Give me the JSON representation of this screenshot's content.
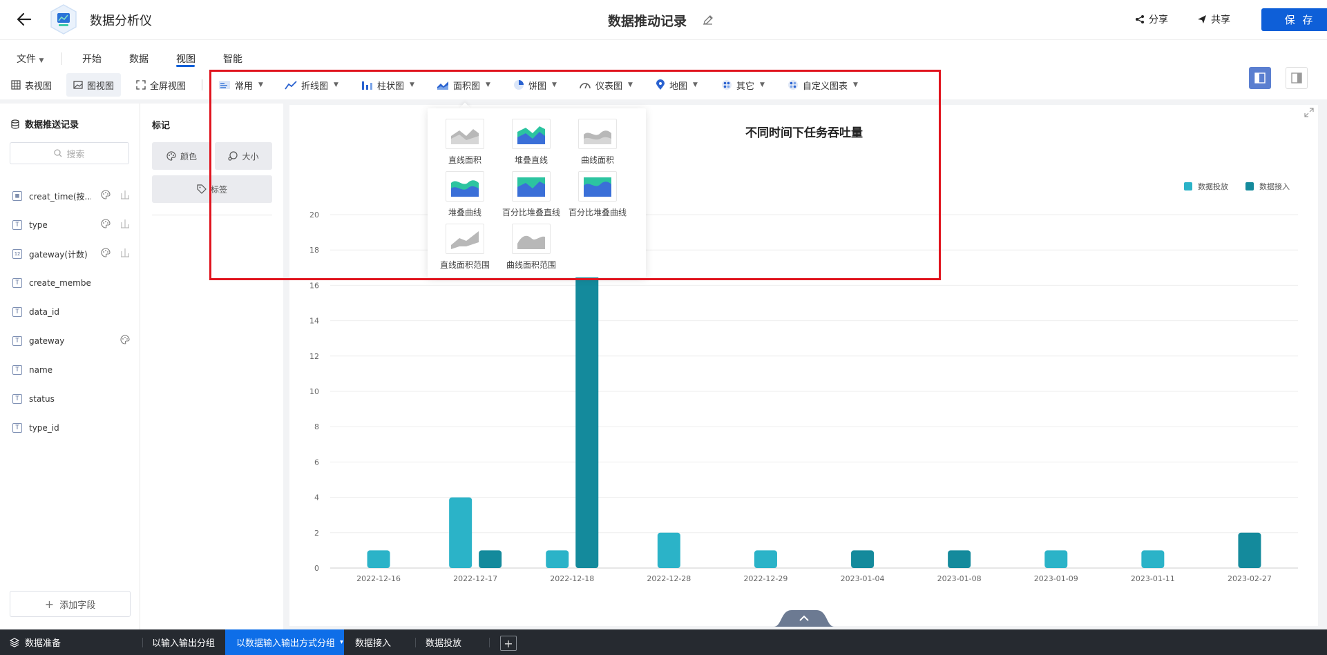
{
  "header": {
    "app_name": "数据分析仪",
    "doc_title": "数据推动记录",
    "share_label": "分享",
    "collab_label": "共享",
    "save_label": "保 存"
  },
  "menu": {
    "file": "文件",
    "start": "开始",
    "data": "数据",
    "view": "视图",
    "smart": "智能"
  },
  "toolbar": {
    "table_view": "表视图",
    "graph_view": "图视图",
    "fullscreen": "全屏视图",
    "common": "常用",
    "line": "折线图",
    "bar": "柱状图",
    "area": "面积图",
    "pie": "饼图",
    "gauge": "仪表图",
    "map": "地图",
    "other": "其它",
    "custom": "自定义图表"
  },
  "field_panel": {
    "title": "数据推送记录",
    "search_placeholder": "搜索",
    "fields": [
      {
        "name": "creat_time(按...",
        "type": "date"
      },
      {
        "name": "type",
        "type": "text"
      },
      {
        "name": "gateway(计数)",
        "type": "number"
      },
      {
        "name": "create_member",
        "type": "text"
      },
      {
        "name": "data_id",
        "type": "text"
      },
      {
        "name": "gateway",
        "type": "text"
      },
      {
        "name": "name",
        "type": "text"
      },
      {
        "name": "status",
        "type": "text"
      },
      {
        "name": "type_id",
        "type": "text"
      }
    ],
    "add_field": "添加字段"
  },
  "mark_panel": {
    "title": "标记",
    "color": "颜色",
    "size": "大小",
    "label": "标签"
  },
  "dropdown": {
    "items": [
      "直线面积",
      "堆叠直线",
      "曲线面积",
      "堆叠曲线",
      "百分比堆叠直线",
      "百分比堆叠曲线",
      "直线面积范围",
      "曲线面积范围"
    ]
  },
  "chart_data": {
    "type": "bar",
    "title": "不同时间下任务吞吐量",
    "categories": [
      "2022-12-16",
      "2022-12-17",
      "2022-12-18",
      "2022-12-28",
      "2022-12-29",
      "2023-01-04",
      "2023-01-08",
      "2023-01-09",
      "2023-01-11",
      "2023-02-27"
    ],
    "series": [
      {
        "name": "数据投放",
        "color": "#2bb3c8",
        "values": [
          1,
          4,
          1,
          2,
          1,
          0,
          0,
          1,
          1,
          0
        ]
      },
      {
        "name": "数据接入",
        "color": "#148a9c",
        "values": [
          0,
          1,
          17,
          0,
          0,
          1,
          1,
          0,
          0,
          2
        ]
      }
    ],
    "ylim": [
      0,
      20
    ],
    "yticks": [
      0,
      2,
      4,
      6,
      8,
      10,
      12,
      14,
      16,
      18,
      20
    ],
    "grid": true,
    "legend": "top-right"
  },
  "bottom_tabs": {
    "prep": "数据准备",
    "tab1": "以输入输出分组",
    "tab2": "以数据输入输出方式分组",
    "tab3": "数据接入",
    "tab4": "数据投放"
  },
  "colors": {
    "accent": "#0e5fd8",
    "highlight": "#e0141e"
  }
}
